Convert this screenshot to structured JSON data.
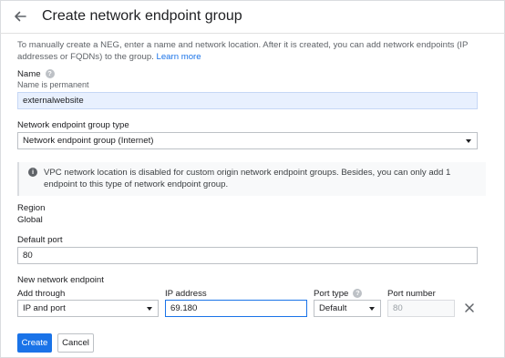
{
  "header": {
    "title": "Create network endpoint group"
  },
  "intro": {
    "text": "To manually create a NEG, enter a name and network location. After it is created, you can add network endpoints (IP addresses or FQDNs) to the group.",
    "link": "Learn more"
  },
  "name_field": {
    "label": "Name",
    "help_glyph": "?",
    "sublabel": "Name is permanent",
    "value": "externalwebsite"
  },
  "neg_type": {
    "label": "Network endpoint group type",
    "selected": "Network endpoint group (Internet)"
  },
  "info": {
    "glyph": "i",
    "text": "VPC network location is disabled for custom origin network endpoint groups. Besides, you can only add 1 endpoint to this type of network endpoint group."
  },
  "region": {
    "label": "Region",
    "value": "Global"
  },
  "default_port": {
    "label": "Default port",
    "value": "80"
  },
  "endpoint": {
    "section_label": "New network endpoint",
    "add_through_label": "Add through",
    "add_through_value": "IP and port",
    "ip_label": "IP address",
    "ip_value": "69.180",
    "port_type_label": "Port type",
    "port_type_help": "?",
    "port_type_value": "Default",
    "port_number_label": "Port number",
    "port_number_value": "80"
  },
  "actions": {
    "create": "Create",
    "cancel": "Cancel"
  }
}
